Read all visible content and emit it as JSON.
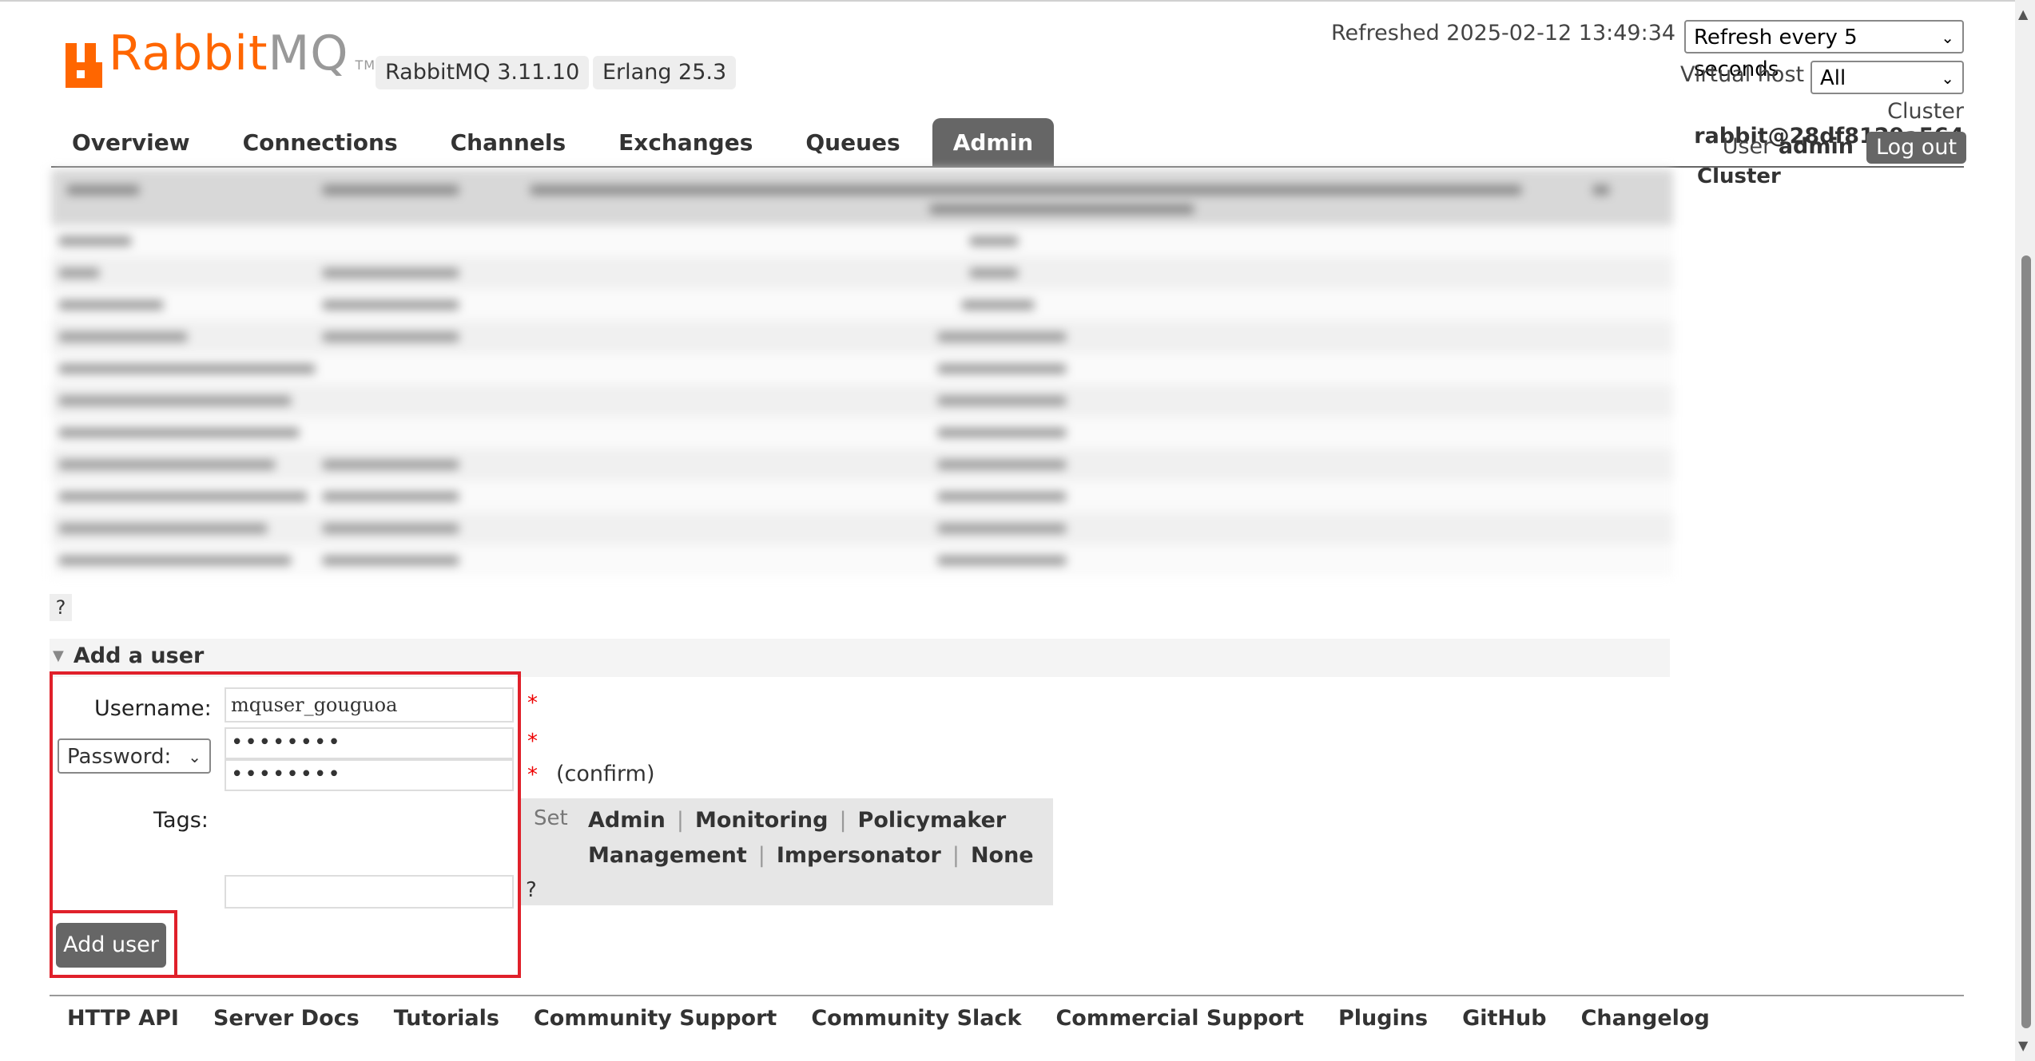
{
  "app": {
    "logo_rabbit": "Rabbit",
    "logo_mq": "MQ",
    "logo_tm": "TM",
    "version_badge": "RabbitMQ 3.11.10",
    "erlang_badge": "Erlang 25.3"
  },
  "status": {
    "refreshed": "Refreshed 2025-02-12 13:49:34",
    "refresh_select": "Refresh every 5 seconds",
    "virtual_host_label": "Virtual host",
    "virtual_host_value": "All",
    "cluster_label": "Cluster",
    "cluster_name": "rabbit@28df8129a564",
    "user_label": "User",
    "user_name": "admin",
    "logout": "Log out",
    "side_cluster": "Cluster"
  },
  "nav": {
    "tabs": [
      "Overview",
      "Connections",
      "Channels",
      "Exchanges",
      "Queues",
      "Admin"
    ],
    "active": "Admin"
  },
  "help_mark": "?",
  "add_user": {
    "section_title": "Add a user",
    "username_label": "Username:",
    "username_value": "mquser_gouguoa",
    "password_mode": "Password:",
    "password_value": "••••••••",
    "password_confirm_value": "••••••••",
    "required_mark": "*",
    "confirm_label": "(confirm)",
    "tags_label": "Tags:",
    "tags_value": "",
    "set_label": "Set",
    "tags": [
      "Admin",
      "Monitoring",
      "Policymaker",
      "Management",
      "Impersonator",
      "None"
    ],
    "tags_help": "?",
    "submit": "Add user"
  },
  "footer": {
    "links": [
      "HTTP API",
      "Server Docs",
      "Tutorials",
      "Community Support",
      "Community Slack",
      "Commercial Support",
      "Plugins",
      "GitHub",
      "Changelog"
    ]
  },
  "colors": {
    "brand_orange": "#ff6600",
    "nav_active": "#666666",
    "highlight_red": "#e0202a"
  }
}
